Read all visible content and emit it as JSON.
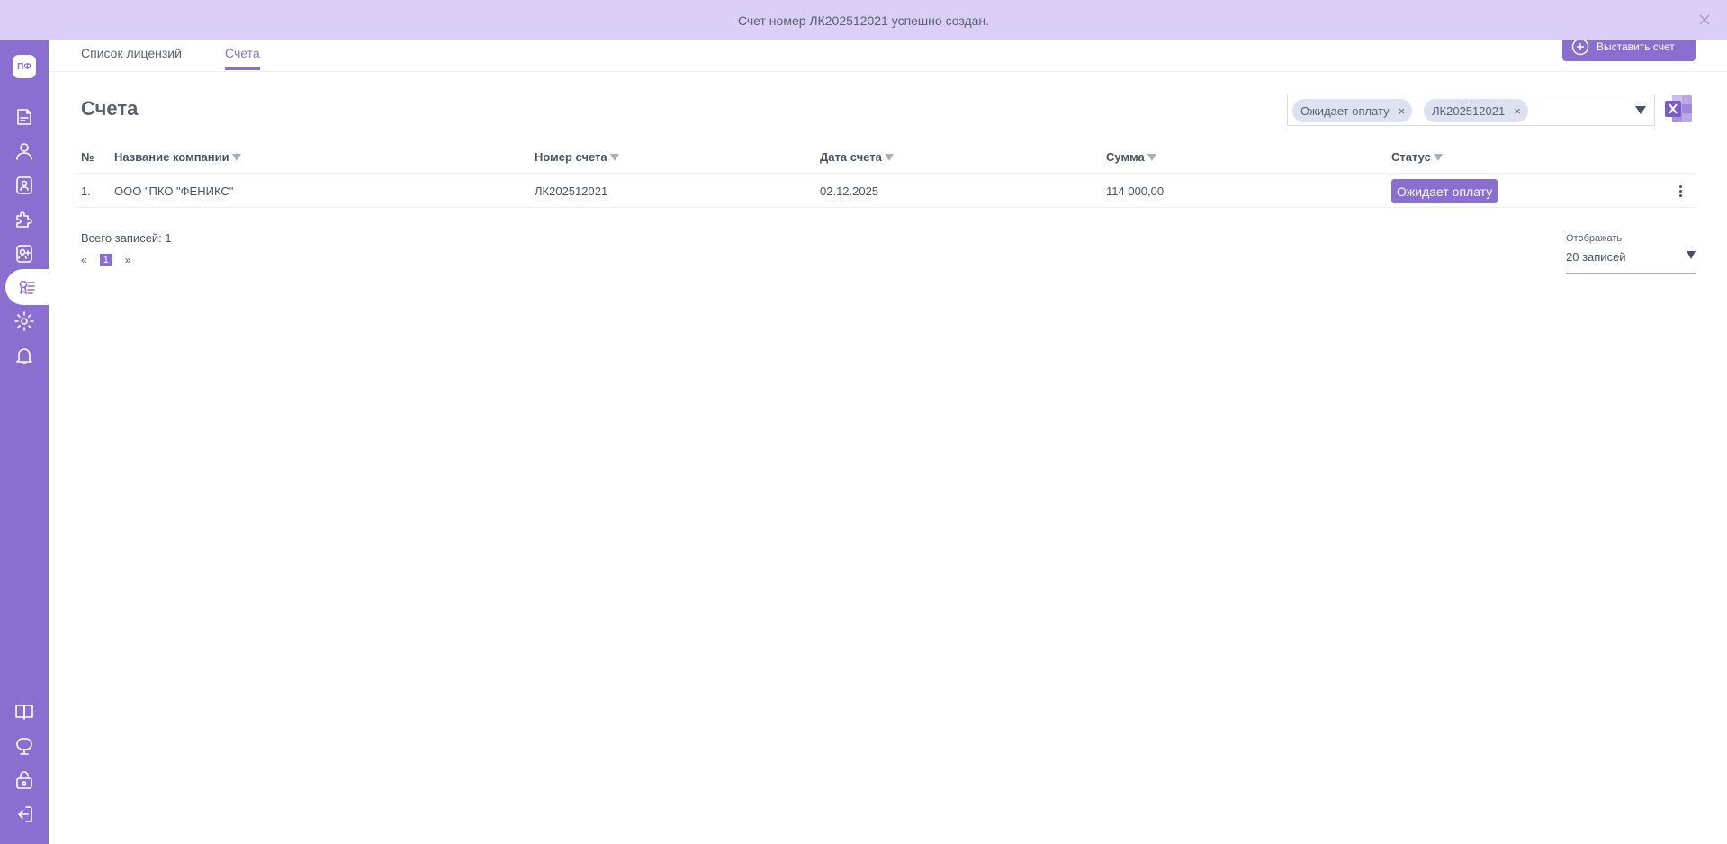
{
  "notification": {
    "text": "Счет номер ЛК202512021 успешно создан."
  },
  "sidebar": {
    "logo": "ПФ",
    "items": [
      {
        "icon": "document-icon"
      },
      {
        "icon": "user-icon"
      },
      {
        "icon": "badge-icon"
      },
      {
        "icon": "puzzle-icon"
      },
      {
        "icon": "add-user-icon"
      },
      {
        "icon": "license-icon",
        "active": true
      },
      {
        "icon": "gear-icon"
      },
      {
        "icon": "bell-icon"
      }
    ],
    "bottom_items": [
      {
        "icon": "book-icon"
      },
      {
        "icon": "support-icon"
      },
      {
        "icon": "lock-icon"
      },
      {
        "icon": "logout-icon"
      }
    ]
  },
  "tabs": [
    {
      "label": "Список лицензий",
      "active": false
    },
    {
      "label": "Счета",
      "active": true
    }
  ],
  "toolbar": {
    "issue_invoice_label": "Выставить счет"
  },
  "page": {
    "title": "Счета"
  },
  "filters": {
    "chips": [
      "Ожидает оплату",
      "ЛК202512021"
    ],
    "remove_symbol": "×"
  },
  "table": {
    "columns": [
      "№",
      "Название компании",
      "Номер счета",
      "Дата счета",
      "Сумма",
      "Статус"
    ],
    "rows": [
      {
        "num": "1.",
        "company": "ООО \"ПКО \"ФЕНИКС\"",
        "invoice_number": "ЛК202512021",
        "date": "02.12.2025",
        "amount": "114 000,00",
        "status": "Ожидает оплату"
      }
    ]
  },
  "footer": {
    "total": "Всего записей: 1",
    "pagination": {
      "prev": "«",
      "current": "1",
      "next": "»"
    },
    "display_label": "Отображать",
    "display_value": "20 записей"
  },
  "colors": {
    "accent": "#8b6fd0",
    "banner": "#dccff7",
    "chip": "#dde2f2"
  }
}
